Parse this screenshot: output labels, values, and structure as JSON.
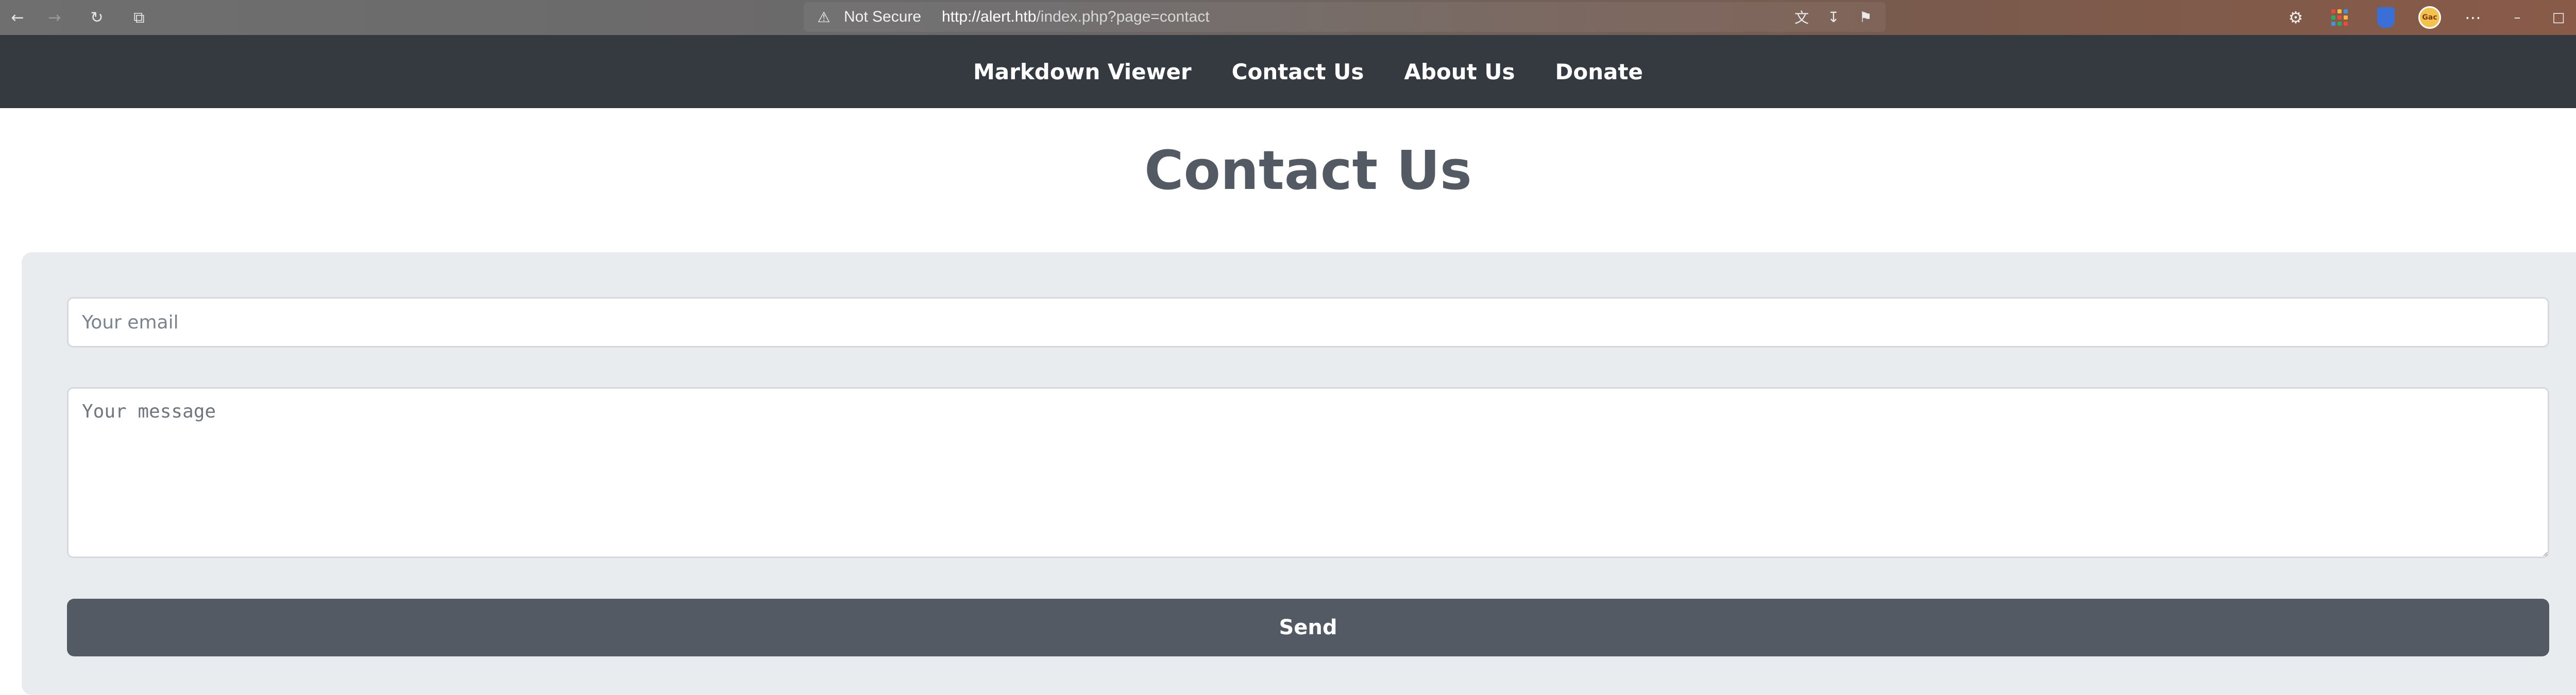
{
  "browser": {
    "security_label": "Not Secure",
    "url_host": "http://alert.htb",
    "url_path": "/index.php?page=contact",
    "icons": {
      "back": "back-arrow-icon",
      "forward": "forward-arrow-icon",
      "reload": "reload-icon",
      "tab_actions": "tab-actions-icon",
      "warning": "warning-icon",
      "translate": "translate-icon",
      "download": "download-icon",
      "bookmark": "bookmark-icon",
      "extensions": "extensions-icon",
      "apps": "apps-grid-icon",
      "shield": "shield-icon",
      "profile": "profile-avatar",
      "menu": "more-menu-icon",
      "minimize": "minimize-icon",
      "maximize": "maximize-icon",
      "close": "close-icon"
    },
    "avatar_text": "Gac"
  },
  "nav": {
    "items": [
      {
        "label": "Markdown Viewer"
      },
      {
        "label": "Contact Us"
      },
      {
        "label": "About Us"
      },
      {
        "label": "Donate"
      }
    ]
  },
  "page": {
    "title": "Contact Us"
  },
  "form": {
    "email": {
      "placeholder": "Your email",
      "value": ""
    },
    "message": {
      "placeholder": "Your message",
      "value": ""
    },
    "send_label": "Send"
  },
  "colors": {
    "nav_background": "#343a40",
    "title_text": "#535a63",
    "card_background": "#e9ecef",
    "button_background": "#535a63"
  }
}
